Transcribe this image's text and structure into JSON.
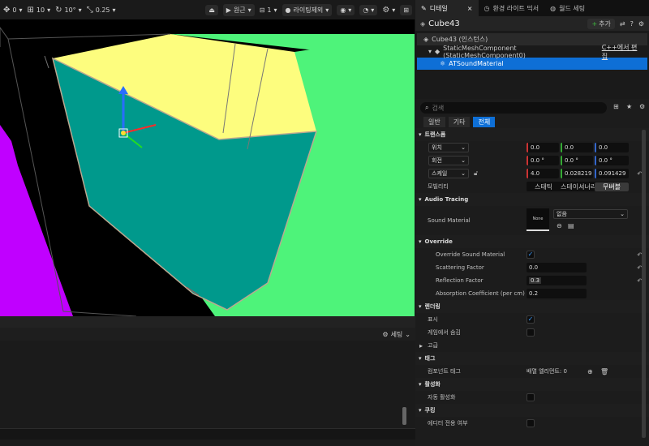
{
  "toolbar": {
    "snap_items": [
      "0",
      "10",
      "10°",
      "0.25"
    ],
    "perspective": "원근",
    "view_count": "1",
    "lighting": "라이팅제외"
  },
  "bottom_panel": {
    "settings_label": "세팅"
  },
  "tabs": [
    {
      "label": "디테일",
      "icon": "pencil-icon"
    },
    {
      "label": "환경 라이트 믹서",
      "icon": "light-mixer-icon"
    },
    {
      "label": "월드 세팅",
      "icon": "globe-icon"
    }
  ],
  "details": {
    "actor_name": "Cube43",
    "add_label": "추가",
    "tree": [
      {
        "label": "Cube43 (인스턴스)",
        "level": 0
      },
      {
        "label": "StaticMeshComponent (StaticMeshComponent0)",
        "level": 1,
        "action": "C++에서 편집"
      },
      {
        "label": "ATSoundMaterial",
        "level": 2,
        "selected": true
      }
    ],
    "search_placeholder": "검색",
    "filters": [
      "일반",
      "기타",
      "전체"
    ],
    "active_filter": "전체"
  },
  "transform": {
    "title": "트랜스폼",
    "location": {
      "label": "위치",
      "values": [
        "0.0",
        "0.0",
        "0.0"
      ]
    },
    "rotation": {
      "label": "회전",
      "values": [
        "0.0 °",
        "0.0 °",
        "0.0 °"
      ]
    },
    "scale": {
      "label": "스케일",
      "values": [
        "4.0",
        "0.028219",
        "0.091429"
      ]
    },
    "mobility": {
      "label": "모빌리티",
      "options": [
        "스태틱",
        "스테이셔너리",
        "무버블"
      ],
      "selected": "무버블"
    }
  },
  "audio_tracing": {
    "title": "Audio Tracing",
    "sound_material_label": "Sound Material",
    "thumb": "None",
    "value": "없음"
  },
  "override": {
    "title": "Override",
    "override_label": "Override Sound Material",
    "override_checked": true,
    "scattering_label": "Scattering Factor",
    "scattering": "0.0",
    "reflection_label": "Reflection Factor",
    "reflection": "0.3",
    "absorption_label": "Absorption Coefficient (per cm)",
    "absorption": "0.2"
  },
  "rendering": {
    "title": "렌더링",
    "visible_label": "표시",
    "visible_checked": true,
    "hidden_in_game_label": "게임에서 숨김",
    "advanced_label": "고급"
  },
  "tags": {
    "title": "태그",
    "component_tags_label": "컴포넌트 태그",
    "component_tags_value": "배열 엘리먼트: 0"
  },
  "activation": {
    "title": "활성화",
    "auto_activate_label": "자동 활성화"
  },
  "cooking": {
    "title": "쿠킹",
    "editor_only_label": "에디터 전용 여부"
  },
  "colors": {
    "accent": "#0e6fd6",
    "yellow": "#fdfd7e",
    "teal": "#00998c",
    "green": "#4ef37a",
    "magenta": "#c000ff"
  }
}
